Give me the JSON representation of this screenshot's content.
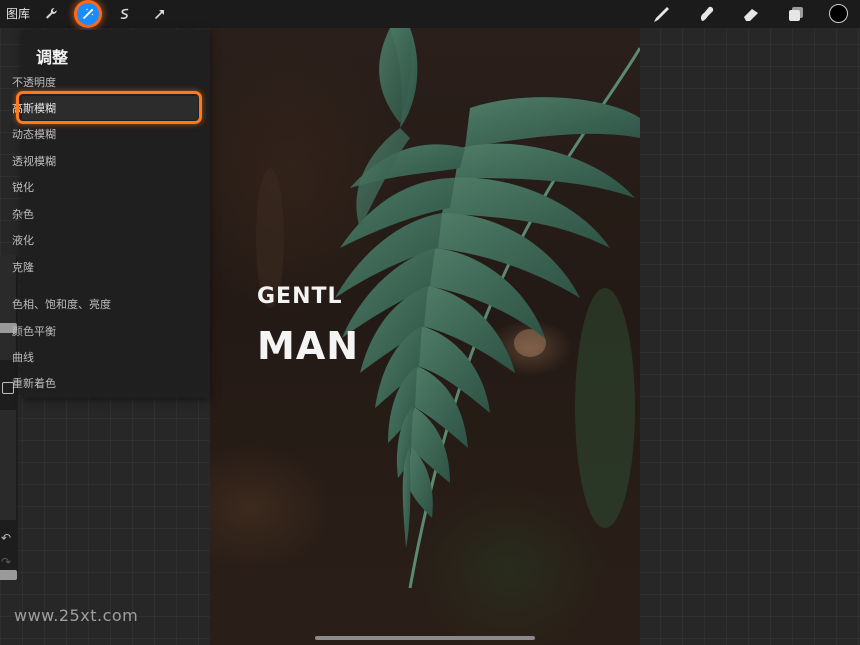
{
  "toolbar": {
    "gallery_label": "图库",
    "tools_left": [
      "wrench-icon",
      "magic-wand-icon",
      "selection-icon",
      "arrow-icon"
    ],
    "tools_right": [
      "brush-icon",
      "smudge-icon",
      "eraser-icon",
      "layers-icon"
    ],
    "active_tool": "adjustments",
    "accent": "#1a8cff",
    "current_color": "#000000"
  },
  "adjustments": {
    "title": "调整",
    "items": [
      {
        "label": "不透明度"
      },
      {
        "label": "高斯模糊",
        "highlighted": true
      },
      {
        "label": "动态模糊"
      },
      {
        "label": "透视模糊"
      },
      {
        "label": "锐化"
      },
      {
        "label": "杂色"
      },
      {
        "label": "液化"
      },
      {
        "label": "克隆"
      },
      {
        "label": "色相、饱和度、亮度"
      },
      {
        "label": "颜色平衡"
      },
      {
        "label": "曲线"
      },
      {
        "label": "重新着色"
      }
    ],
    "highlight_color": "#ff7a1a"
  },
  "canvas": {
    "title_line1": "GENTL",
    "title_line2": "MAN"
  },
  "watermark": "www.25xt.com"
}
